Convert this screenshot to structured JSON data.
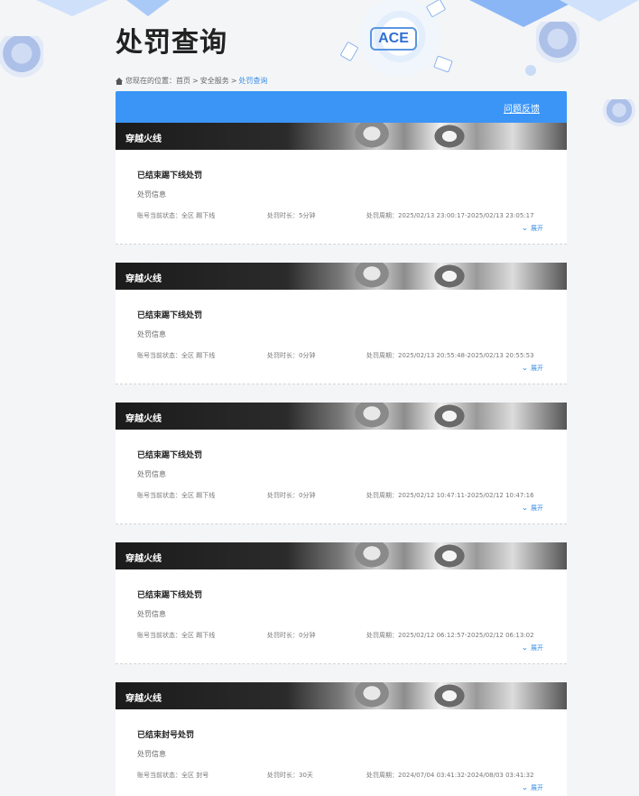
{
  "page": {
    "title": "处罚查询"
  },
  "decor": {
    "logo_text": "ACE"
  },
  "breadcrumb": {
    "prefix": "您现在的位置：",
    "items": [
      "首页",
      "安全服务",
      "处罚查询"
    ],
    "separator": ">"
  },
  "header_bar": {
    "feedback_label": "问题反馈",
    "color": "#3a95f7"
  },
  "records": [
    {
      "game": "穿越火线",
      "status": "已结束踢下线处罚",
      "info_label": "处罚信息",
      "account_status": "账号当前状态：全区 踢下线",
      "duration": "处罚时长：5分钟",
      "period": "处罚周期：2025/02/13 23:00:17-2025/02/13 23:05:17",
      "expand_label": "展开"
    },
    {
      "game": "穿越火线",
      "status": "已结束踢下线处罚",
      "info_label": "处罚信息",
      "account_status": "账号当前状态：全区 踢下线",
      "duration": "处罚时长：0分钟",
      "period": "处罚周期：2025/02/13 20:55:48-2025/02/13 20:55:53",
      "expand_label": "展开"
    },
    {
      "game": "穿越火线",
      "status": "已结束踢下线处罚",
      "info_label": "处罚信息",
      "account_status": "账号当前状态：全区 踢下线",
      "duration": "处罚时长：0分钟",
      "period": "处罚周期：2025/02/12 10:47:11-2025/02/12 10:47:16",
      "expand_label": "展开"
    },
    {
      "game": "穿越火线",
      "status": "已结束踢下线处罚",
      "info_label": "处罚信息",
      "account_status": "账号当前状态：全区 踢下线",
      "duration": "处罚时长：0分钟",
      "period": "处罚周期：2025/02/12 06:12:57-2025/02/12 06:13:02",
      "expand_label": "展开"
    },
    {
      "game": "穿越火线",
      "status": "已结束封号处罚",
      "info_label": "处罚信息",
      "account_status": "账号当前状态：全区 封号",
      "duration": "处罚时长：30天",
      "period": "处罚周期：2024/07/04 03:41:32-2024/08/03 03:41:32",
      "expand_label": "展开"
    }
  ]
}
